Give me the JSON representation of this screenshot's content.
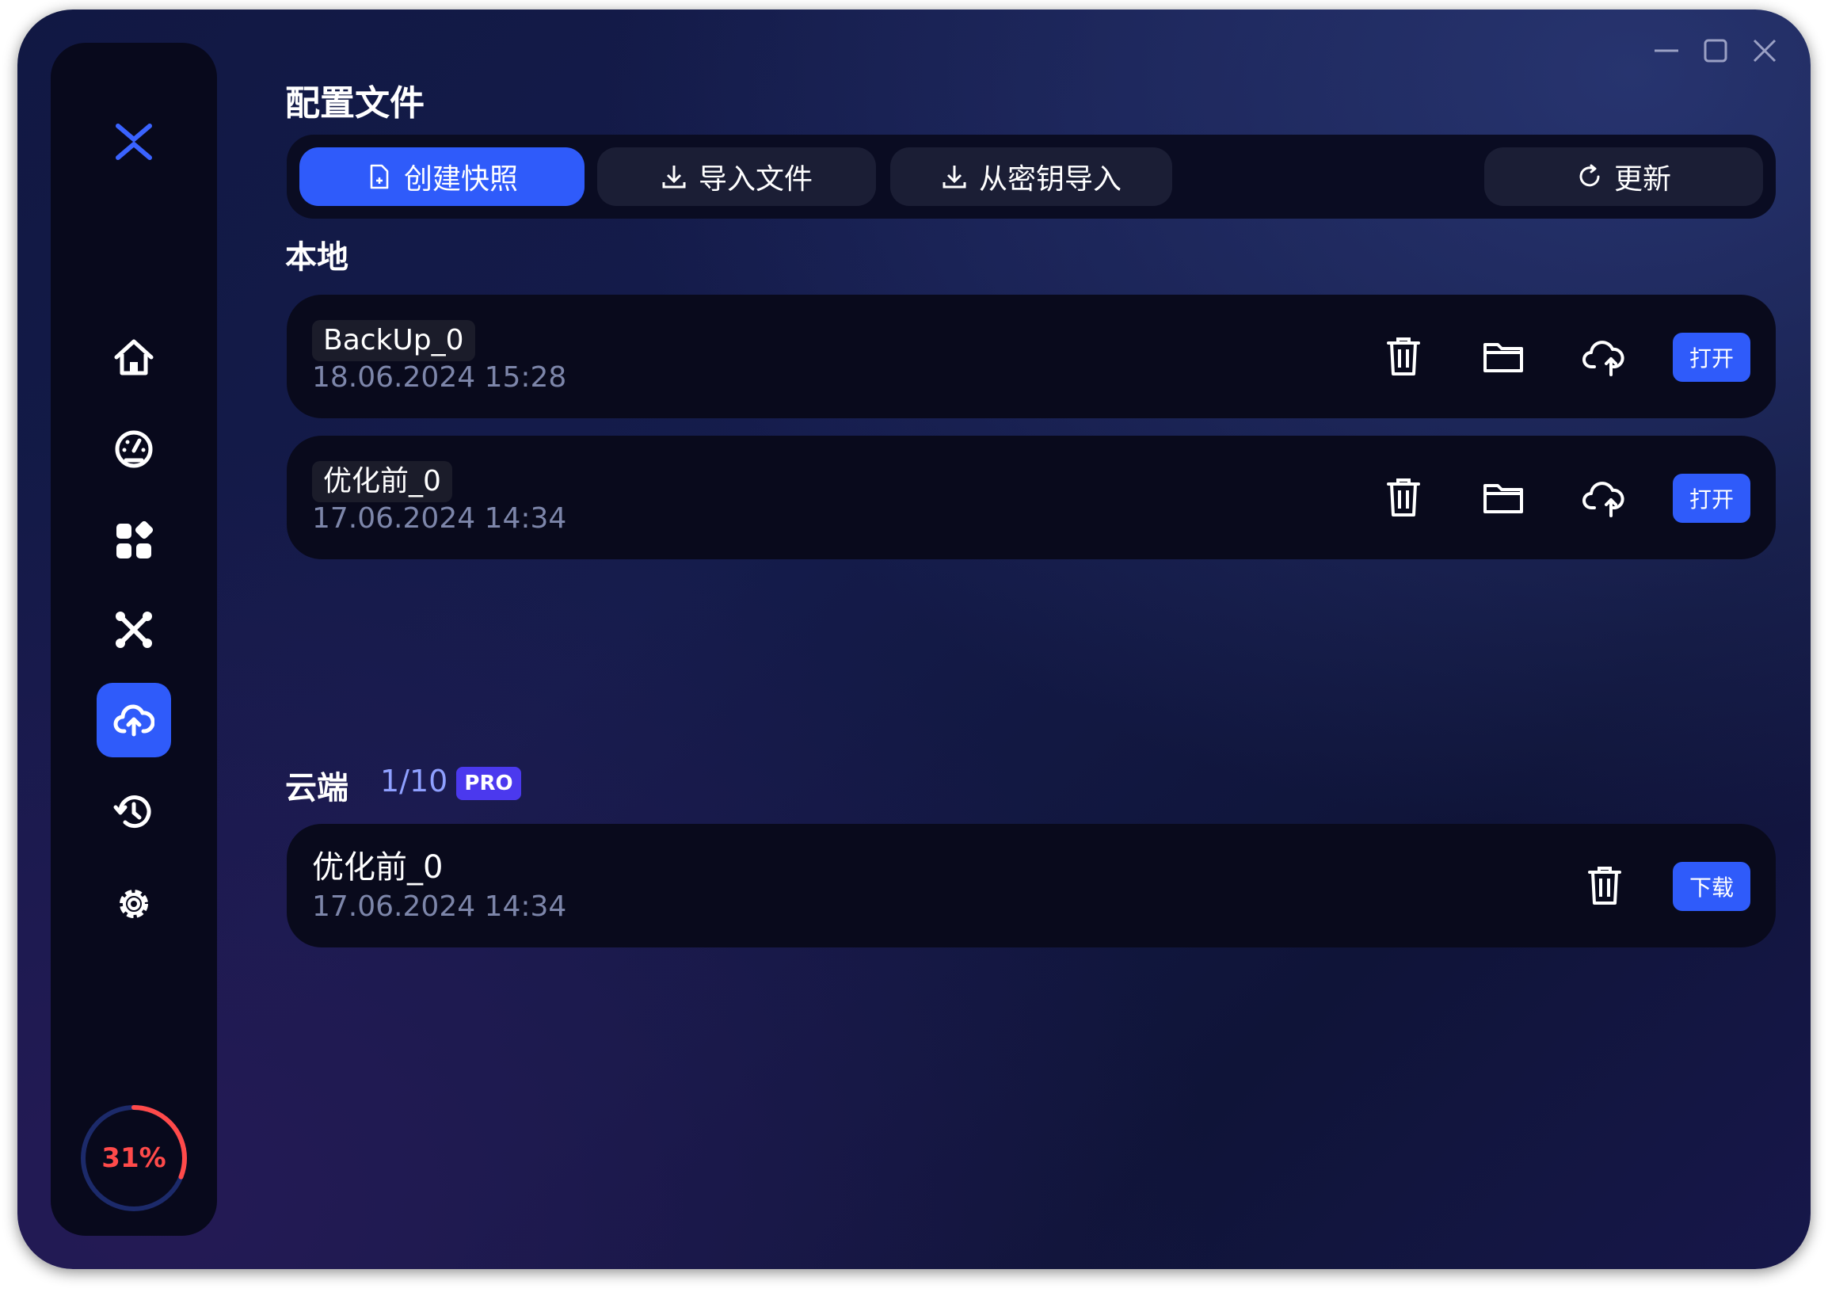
{
  "colors": {
    "accent": "#2f5bfa",
    "pro": "#4b39ee",
    "progress": "#ff4a4a"
  },
  "titlebar": {
    "icons": [
      "minimize-icon",
      "maximize-icon",
      "close-icon"
    ]
  },
  "sidebar": {
    "logo_icon": "x-logo-icon",
    "items": [
      {
        "icon": "home-icon"
      },
      {
        "icon": "speedometer-icon"
      },
      {
        "icon": "apps-grid-icon"
      },
      {
        "icon": "network-tools-icon"
      },
      {
        "icon": "cloud-upload-icon",
        "active": true
      },
      {
        "icon": "history-restore-icon"
      },
      {
        "icon": "settings-gear-icon"
      }
    ],
    "progress": {
      "value": 0.31,
      "label": "31%"
    }
  },
  "page": {
    "title": "配置文件",
    "toolbar": {
      "create_snapshot": "创建快照",
      "import_file": "导入文件",
      "import_from_key": "从密钥导入",
      "refresh": "更新"
    },
    "local": {
      "title": "本地",
      "items": [
        {
          "name": "BackUp_0",
          "date": "18.06.2024 15:28",
          "open_label": "打开"
        },
        {
          "name": "优化前_0",
          "date": "17.06.2024 14:34",
          "open_label": "打开"
        }
      ]
    },
    "cloud": {
      "title": "云端",
      "count": "1/10",
      "badge": "PRO",
      "items": [
        {
          "name": "优化前_0",
          "date": "17.06.2024 14:34",
          "download_label": "下载"
        }
      ]
    }
  }
}
